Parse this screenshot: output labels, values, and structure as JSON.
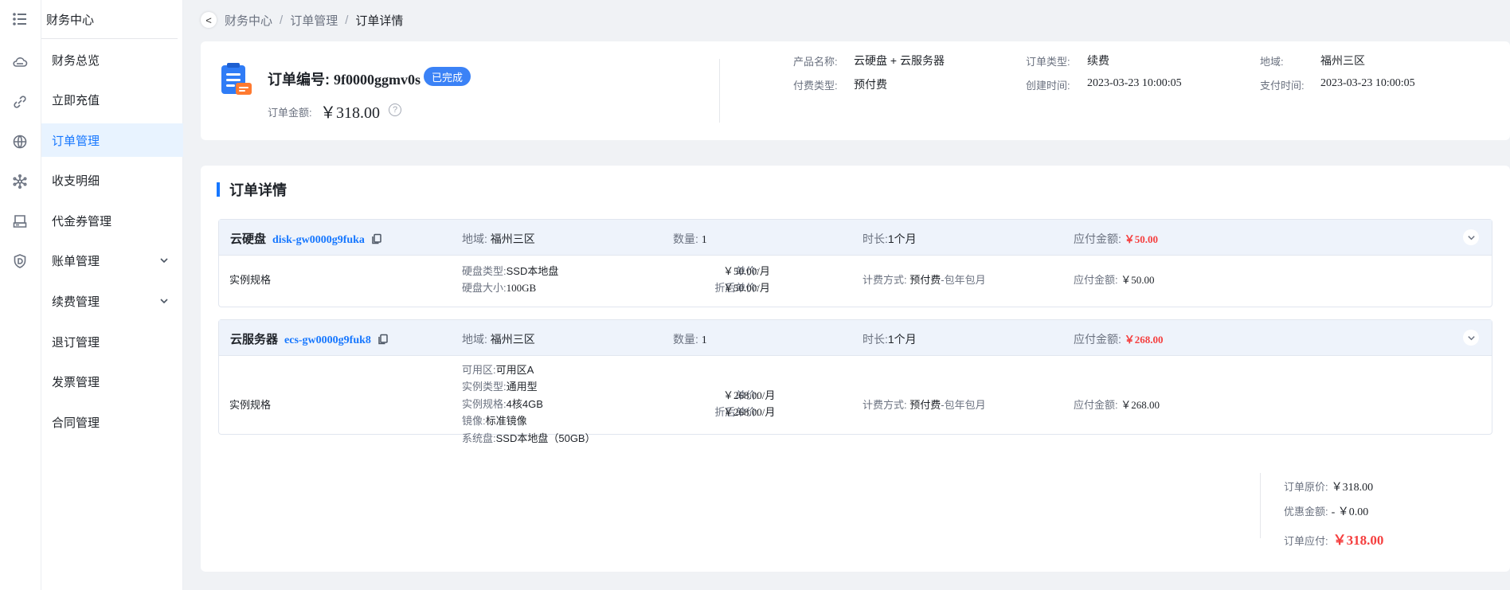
{
  "sidebar": {
    "title": "财务中心",
    "items": [
      {
        "label": "财务总览"
      },
      {
        "label": "立即充值"
      },
      {
        "label": "订单管理"
      },
      {
        "label": "收支明细"
      },
      {
        "label": "代金券管理"
      },
      {
        "label": "账单管理"
      },
      {
        "label": "续费管理"
      },
      {
        "label": "退订管理"
      },
      {
        "label": "发票管理"
      },
      {
        "label": "合同管理"
      }
    ],
    "active_item": "订单管理"
  },
  "rail_icons": [
    "menu-icon",
    "cloud-icon",
    "link-icon",
    "globe-icon",
    "network-icon",
    "storage-icon",
    "shield-icon"
  ],
  "breadcrumb": {
    "back": "<",
    "items": [
      "财务中心",
      "订单管理",
      "订单详情"
    ],
    "separator": "/"
  },
  "summary": {
    "order_no_label": "订单编号:",
    "order_no": "9f0000ggmv0s",
    "status": "已完成",
    "amount_label": "订单金额:",
    "amount": "￥318.00",
    "help": "?",
    "fields": {
      "product_label": "产品名称:",
      "product": "云硬盘 + 云服务器",
      "order_type_label": "订单类型:",
      "order_type": "续费",
      "region_label": "地域:",
      "region": "福州三区",
      "pay_type_label": "付费类型:",
      "pay_type": "预付费",
      "created_label": "创建时间:",
      "created": "2023-03-23 10:00:05",
      "paid_label": "支付时间:",
      "paid": "2023-03-23 10:00:05"
    }
  },
  "detail": {
    "title": "订单详情",
    "items": [
      {
        "name": "云硬盘",
        "resource_id": "disk-gw0000g9fuka",
        "region_label": "地域:",
        "region": "福州三区",
        "qty_label": "数量:",
        "qty": "1",
        "duration_label": "时长:",
        "duration": "1个月",
        "payable_label": "应付金额:",
        "payable": "￥50.00",
        "spec_label": "实例规格",
        "specs": [
          {
            "k": "硬盘类型:",
            "v": "SSD本地盘"
          },
          {
            "k": "硬盘大小:",
            "v": "100GB"
          }
        ],
        "unit_price_label": "单价:",
        "unit_price": "￥50.00/月",
        "discount_price_label": "折后单价:",
        "discount_price": "￥50.00/月",
        "billing_label": "计费方式:",
        "billing_main": "预付费",
        "billing_sub": "-包年包月",
        "row_payable_label": "应付金额:",
        "row_payable": "￥50.00"
      },
      {
        "name": "云服务器",
        "resource_id": "ecs-gw0000g9fuk8",
        "region_label": "地域:",
        "region": "福州三区",
        "qty_label": "数量:",
        "qty": "1",
        "duration_label": "时长:",
        "duration": "1个月",
        "payable_label": "应付金额:",
        "payable": "￥268.00",
        "spec_label": "实例规格",
        "specs": [
          {
            "k": "可用区:",
            "v": "可用区A"
          },
          {
            "k": "实例类型:",
            "v": "通用型"
          },
          {
            "k": "实例规格:",
            "v": "4核4GB"
          },
          {
            "k": "镜像:",
            "v": "标准镜像"
          },
          {
            "k": "系统盘:",
            "v": "SSD本地盘（50GB）"
          }
        ],
        "unit_price_label": "单价:",
        "unit_price": "￥268.00/月",
        "discount_price_label": "折后单价:",
        "discount_price": "￥268.00/月",
        "billing_label": "计费方式:",
        "billing_main": "预付费",
        "billing_sub": "-包年包月",
        "row_payable_label": "应付金额:",
        "row_payable": "￥268.00"
      }
    ],
    "totals": {
      "original_label": "订单原价:",
      "original": "￥318.00",
      "discount_label": "优惠金额:",
      "discount": "- ￥0.00",
      "due_label": "订单应付:",
      "due": "￥318.00"
    }
  },
  "colors": {
    "accent": "#1677ff",
    "price_red": "#f53f3f",
    "badge_blue": "#3b82f6",
    "row_head_bg": "#eef3fb"
  }
}
